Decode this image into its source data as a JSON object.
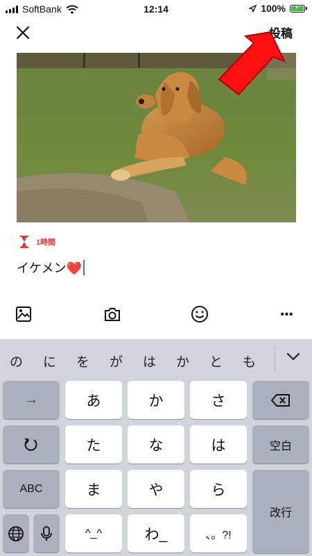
{
  "status": {
    "carrier": "SoftBank",
    "time": "12:14",
    "battery": "100%"
  },
  "header": {
    "post_label": "投稿"
  },
  "composer": {
    "timer_label": "1時間",
    "message": "イケメン❤️"
  },
  "toolbar": {
    "more_label": "•••"
  },
  "keyboard": {
    "suggestions": [
      "の",
      "に",
      "を",
      "が",
      "は",
      "か",
      "と",
      "も"
    ],
    "row1": [
      "→",
      "あ",
      "か",
      "さ"
    ],
    "row2": [
      "た",
      "な",
      "は",
      "空白"
    ],
    "row3": [
      "ABC",
      "ま",
      "や",
      "ら",
      "改行"
    ],
    "row4": [
      "^_^",
      "わ_",
      "、。?!"
    ]
  },
  "colors": {
    "timer_accent": "#e23b3b",
    "caret": "#4a6cf7",
    "keyboard_bg": "#d1d4db",
    "battery_fill": "#3cc13b",
    "arrow": "#ff0000"
  },
  "icons": {
    "close": "close-icon",
    "image": "image-icon",
    "camera": "camera-icon",
    "emoji": "emoji-icon",
    "globe": "globe-icon",
    "mic": "mic-icon",
    "backspace": "backspace-icon",
    "undo": "undo-icon",
    "chevron": "chevron-down-icon"
  }
}
